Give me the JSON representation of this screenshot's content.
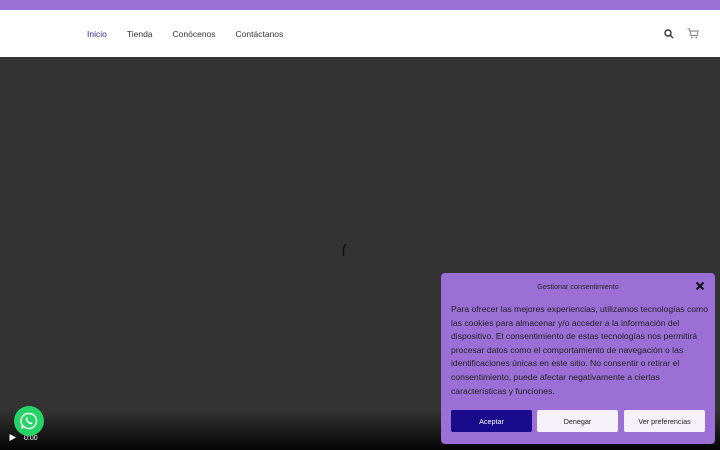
{
  "nav": {
    "items": [
      {
        "label": "Inicio",
        "active": true
      },
      {
        "label": "Tienda",
        "active": false
      },
      {
        "label": "Conócenos",
        "active": false
      },
      {
        "label": "Contáctanos",
        "active": false
      }
    ]
  },
  "header_icons": [
    "search-icon",
    "cart-icon"
  ],
  "video": {
    "current_time": "0:00"
  },
  "consent": {
    "title": "Gestionar consentimiento",
    "body": "Para ofrecer las mejores experiencias, utilizamos tecnologías como las cookies para almacenar y/o acceder a la información del dispositivo. El consentimiento de estas tecnologías nos permitirá procesar datos como el comportamiento de navegación o las identificaciones únicas en este sitio. No consentir o retirar el consentimiento, puede afectar negativamente a ciertas características y funciones.",
    "accept_label": "Aceptar",
    "deny_label": "Denegar",
    "prefs_label": "Ver preferencias"
  },
  "colors": {
    "accent": "#9b6fd6",
    "primary_button": "#1a0a8c",
    "active_nav": "#2b2a8f",
    "whatsapp": "#25d366"
  }
}
